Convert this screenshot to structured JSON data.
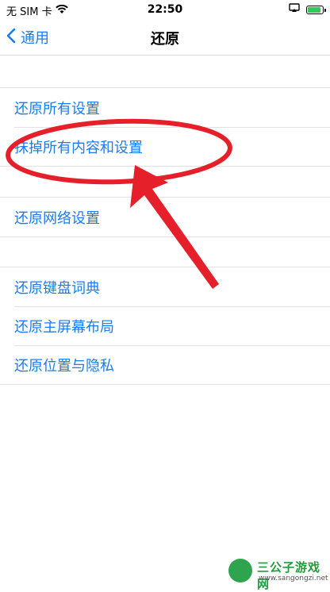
{
  "status_bar": {
    "carrier": "无 SIM 卡",
    "time": "22:50"
  },
  "nav": {
    "back_label": "通用",
    "title": "还原"
  },
  "groups": [
    {
      "items": [
        "还原所有设置",
        "抹掉所有内容和设置"
      ]
    },
    {
      "items": [
        "还原网络设置"
      ]
    },
    {
      "items": [
        "还原键盘词典",
        "还原主屏幕布局",
        "还原位置与隐私"
      ]
    }
  ],
  "colors": {
    "accent": "#1a7cf0",
    "annotation": "#e5202a",
    "battery": "#34c759"
  },
  "watermark": {
    "title": "三公子游戏网",
    "url": "www.sangongzi.net"
  }
}
